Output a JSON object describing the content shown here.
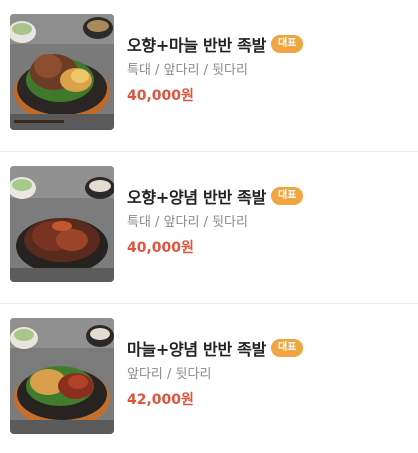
{
  "colors": {
    "badge_bg": "#f0a540",
    "price": "#e0533d"
  },
  "menu": {
    "items": [
      {
        "name": "오향+마늘 반반 족발",
        "badge": "대표",
        "options": "특대 / 앞다리 / 뒷다리",
        "price": "40,000원",
        "image": "jokbal-ohyang-garlic-photo"
      },
      {
        "name": "오향+양념 반반 족발",
        "badge": "대표",
        "options": "특대 / 앞다리 / 뒷다리",
        "price": "40,000원",
        "image": "jokbal-ohyang-seasoned-photo"
      },
      {
        "name": "마늘+양념 반반 족발",
        "badge": "대표",
        "options": "앞다리 / 뒷다리",
        "price": "42,000원",
        "image": "jokbal-garlic-seasoned-photo"
      }
    ]
  }
}
